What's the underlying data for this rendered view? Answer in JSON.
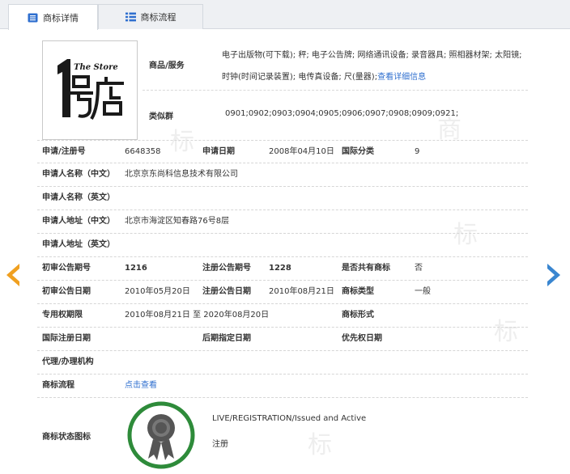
{
  "tabs": [
    {
      "label": "商标详情",
      "active": true,
      "icon": "document-icon"
    },
    {
      "label": "商标流程",
      "active": false,
      "icon": "list-icon"
    }
  ],
  "logo": {
    "text_top": "The Store",
    "text_main": "1号店"
  },
  "goods": {
    "label": "商品/服务",
    "text": "电子出版物(可下载); 秤; 电子公告牌; 网络通讯设备; 录音器具; 照相器材架; 太阳镜; 时钟(时间记录装置); 电传真设备; 尺(量器);",
    "link": "查看详细信息"
  },
  "similar": {
    "label": "类似群",
    "value": "0901;0902;0903;0904;0905;0906;0907;0908;0909;0921;"
  },
  "fields": {
    "reg_no": {
      "label": "申请/注册号",
      "value": "6648358"
    },
    "app_date": {
      "label": "申请日期",
      "value": "2008年04月10日"
    },
    "intl_class": {
      "label": "国际分类",
      "value": "9"
    },
    "applicant_cn": {
      "label": "申请人名称（中文）",
      "value": "北京京东尚科信息技术有限公司"
    },
    "applicant_en": {
      "label": "申请人名称（英文）",
      "value": ""
    },
    "address_cn": {
      "label": "申请人地址（中文）",
      "value": "北京市海淀区知春路76号8层"
    },
    "address_en": {
      "label": "申请人地址（英文）",
      "value": ""
    },
    "prelim_no": {
      "label": "初审公告期号",
      "value": "1216"
    },
    "reg_notice_no": {
      "label": "注册公告期号",
      "value": "1228"
    },
    "shared": {
      "label": "是否共有商标",
      "value": "否"
    },
    "prelim_date": {
      "label": "初审公告日期",
      "value": "2010年05月20日"
    },
    "reg_notice_date": {
      "label": "注册公告日期",
      "value": "2010年08月21日"
    },
    "tm_type": {
      "label": "商标类型",
      "value": "一般"
    },
    "exclusive_period": {
      "label": "专用权期限",
      "value": "2010年08月21日 至 2020年08月20日"
    },
    "tm_form": {
      "label": "商标形式",
      "value": ""
    },
    "intl_reg_date": {
      "label": "国际注册日期",
      "value": ""
    },
    "later_date": {
      "label": "后期指定日期",
      "value": ""
    },
    "priority_date": {
      "label": "优先权日期",
      "value": ""
    },
    "agent": {
      "label": "代理/办理机构",
      "value": ""
    },
    "process": {
      "label": "商标流程",
      "link": "点击查看"
    }
  },
  "status": {
    "label": "商标状态图标",
    "en": "LIVE/REGISTRATION/Issued and Active",
    "cn": "注册",
    "badge_icon": "award-ribbon-icon",
    "badge_ring_color": "#2e8b3a"
  },
  "colors": {
    "link": "#2f6fcf",
    "arrow_left": "#f0a020",
    "arrow_right": "#3a86d0"
  }
}
